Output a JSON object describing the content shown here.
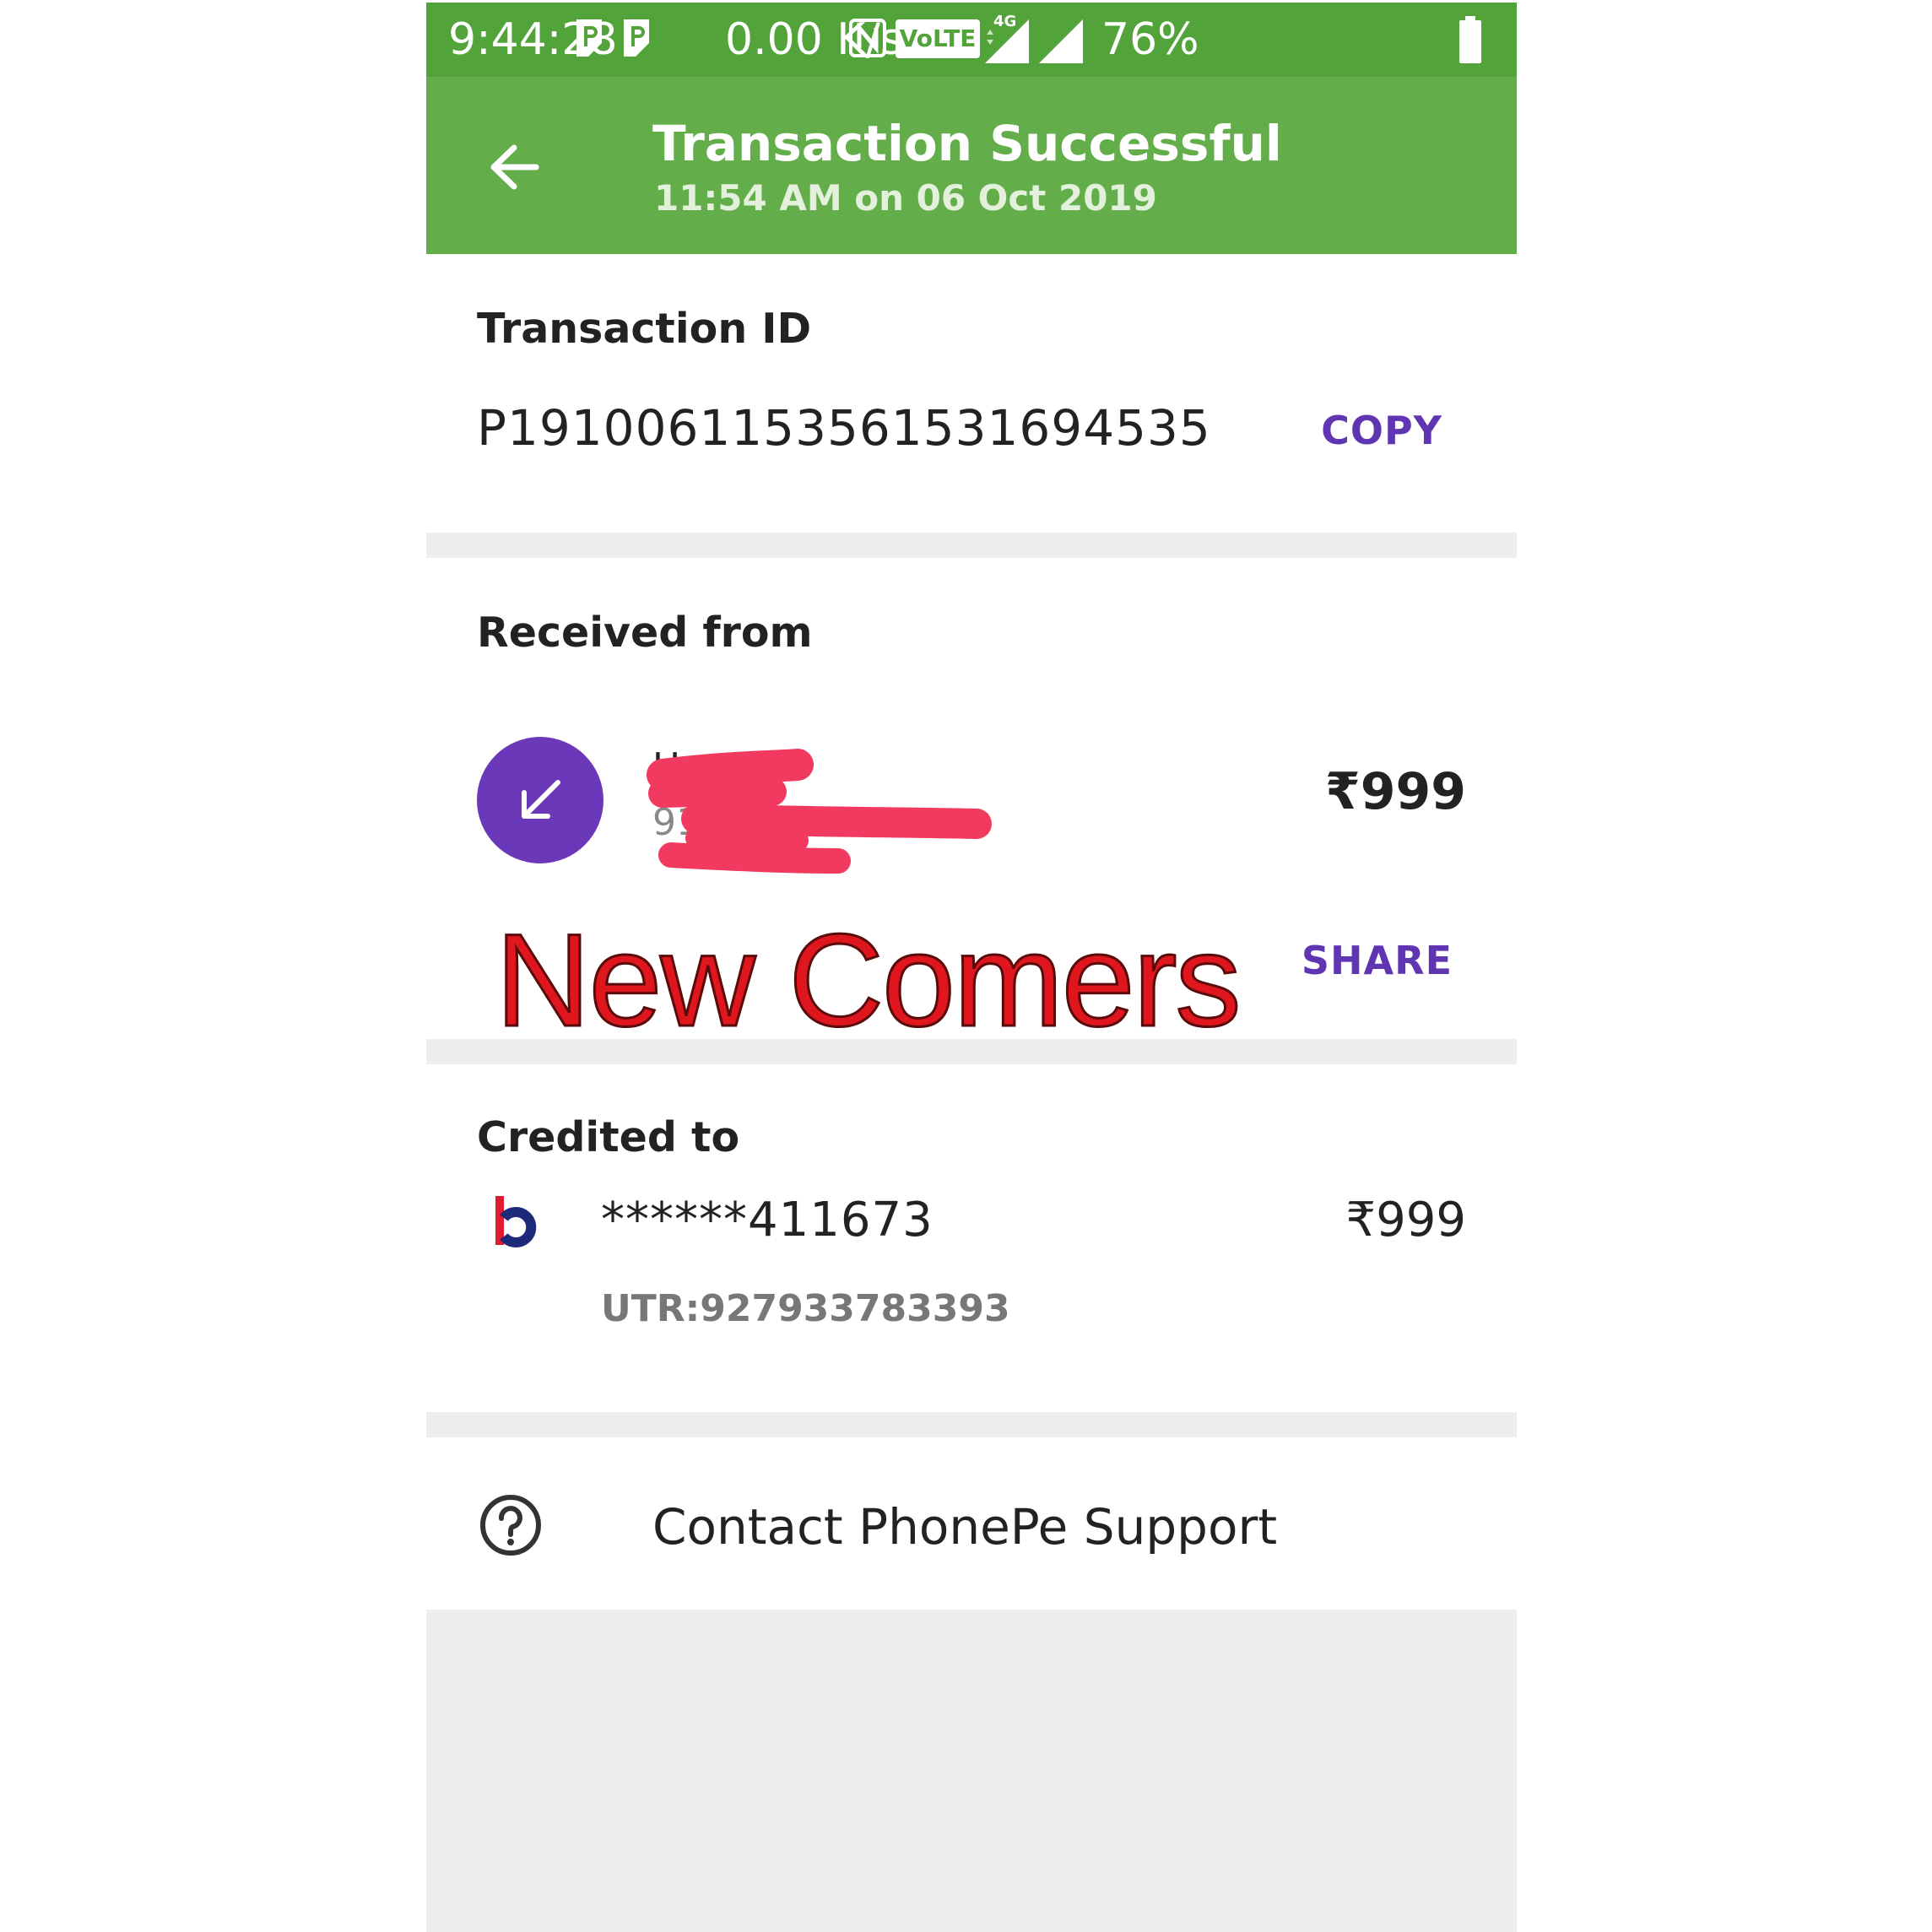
{
  "status_bar": {
    "time": "9:44:28",
    "network_speed": "0.00 K/s",
    "volte_badge": "VoLTE",
    "network_type": "4G",
    "battery": "76%",
    "icons": [
      "parking-icon",
      "parking-icon",
      "nfc-icon",
      "volte-icon",
      "signal-icon",
      "signal-icon",
      "battery-icon"
    ]
  },
  "header": {
    "title": "Transaction Successful",
    "subtitle": "11:54 AM on 06 Oct 2019",
    "back_icon": "arrow-left-icon"
  },
  "transaction": {
    "label": "Transaction ID",
    "id": "P1910061153561531694535",
    "copy_label": "COPY"
  },
  "received_from": {
    "label": "Received from",
    "icon": "arrow-down-left-icon",
    "name_visible": "H",
    "phone_visible": "91",
    "amount": "₹999",
    "share_label": "SHARE"
  },
  "overlay": {
    "text": "New Comers"
  },
  "credited_to": {
    "label": "Credited to",
    "bank_icon": "bank-logo-icon",
    "account": "******411673",
    "amount": "₹999",
    "utr": "UTR:927933783393"
  },
  "support": {
    "label": "Contact PhonePe Support",
    "icon": "help-circle-icon"
  },
  "colors": {
    "status_bar": "#52a43a",
    "header": "#63ad4a",
    "accent_purple": "#6035b2",
    "avatar": "#6a38b8",
    "redaction": "#f23a60",
    "overlay_text": "#e0161e",
    "separator": "#eeeeee"
  }
}
